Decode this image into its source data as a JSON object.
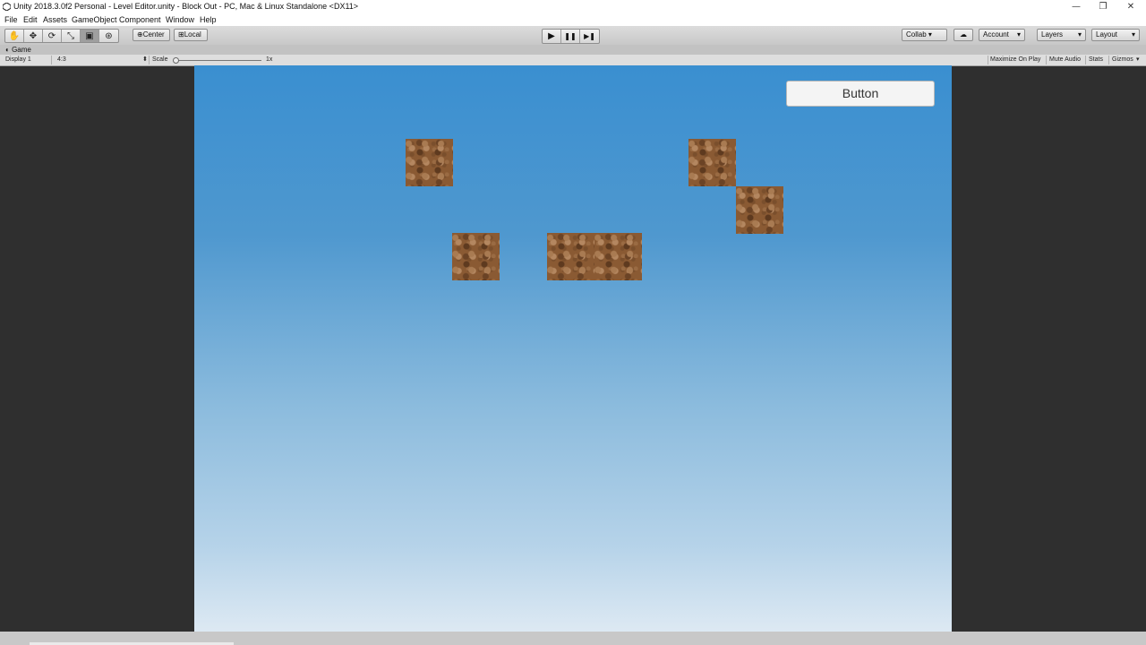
{
  "window": {
    "title": "Unity 2018.3.0f2 Personal - Level Editor.unity - Block Out - PC, Mac & Linux Standalone <DX11>",
    "minimize_glyph": "—",
    "restore_glyph": "❐",
    "close_glyph": "✕"
  },
  "menu": [
    "File",
    "Edit",
    "Assets",
    "GameObject",
    "Component",
    "Window",
    "Help"
  ],
  "toolbar": {
    "tools": [
      {
        "name": "hand-tool",
        "icon": "hand-icon",
        "glyph": "✋"
      },
      {
        "name": "move-tool",
        "icon": "move-icon",
        "glyph": "✥"
      },
      {
        "name": "rotate-tool",
        "icon": "rotate-icon",
        "glyph": "⟳"
      },
      {
        "name": "scale-tool",
        "icon": "scale-icon",
        "glyph": "⤡"
      },
      {
        "name": "rect-tool",
        "icon": "rect-icon",
        "glyph": "▣"
      },
      {
        "name": "transform-tool",
        "icon": "transform-icon",
        "glyph": "⊛"
      }
    ],
    "pivot_center": "Center",
    "pivot_local": "Local",
    "play_glyph": "▶",
    "pause_glyph": "❚❚",
    "step_glyph": "▶❚",
    "collab": "Collab ▾",
    "cloud_glyph": "☁",
    "account": "Account",
    "layers": "Layers",
    "layout": "Layout",
    "dropdown_glyph": "▾"
  },
  "tab": {
    "label": "Game"
  },
  "game_toolbar": {
    "display": "Display 1",
    "aspect": "4:3",
    "scale_label": "Scale",
    "scale_value": "1x",
    "maximize_on_play": "Maximize On Play",
    "mute_audio": "Mute Audio",
    "stats": "Stats",
    "gizmos": "Gizmos"
  },
  "game": {
    "button_label": "Button"
  }
}
